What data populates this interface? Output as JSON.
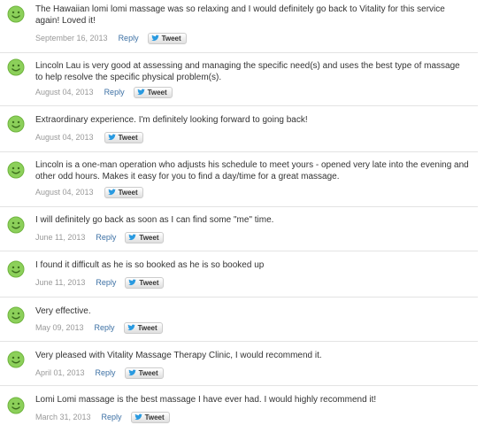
{
  "reviews": [
    {
      "text": "The Hawaiian lomi lomi massage was so relaxing and I would definitely go back to Vitality for this service again! Loved it!",
      "date": "September 16, 2013",
      "reply": "Reply",
      "tweet": "Tweet"
    },
    {
      "text": "Lincoln Lau is very good at assessing and managing the specific need(s) and uses the best type of massage to help resolve the specific physical problem(s).",
      "date": "August 04, 2013",
      "reply": "Reply",
      "tweet": "Tweet"
    },
    {
      "text": "Extraordinary experience. I'm definitely looking forward to going back!",
      "date": "August 04, 2013",
      "reply": "",
      "tweet": "Tweet"
    },
    {
      "text": "Lincoln is a one-man operation who adjusts his schedule to meet yours - opened very late into the evening and other odd hours. Makes it easy for you to find a day/time for a great massage.",
      "date": "August 04, 2013",
      "reply": "",
      "tweet": "Tweet"
    },
    {
      "text": "I will definitely go back as soon as I can find some \"me\" time.",
      "date": "June 11, 2013",
      "reply": "Reply",
      "tweet": "Tweet"
    },
    {
      "text": "I found it difficult as he is so booked as he is so booked up",
      "date": "June 11, 2013",
      "reply": "Reply",
      "tweet": "Tweet"
    },
    {
      "text": "Very effective.",
      "date": "May 09, 2013",
      "reply": "Reply",
      "tweet": "Tweet"
    },
    {
      "text": "Very pleased with Vitality Massage Therapy Clinic, I would recommend it.",
      "date": "April 01, 2013",
      "reply": "Reply",
      "tweet": "Tweet"
    },
    {
      "text": "Lomi Lomi massage is the best massage I have ever had. I would highly recommend it!",
      "date": "March 31, 2013",
      "reply": "Reply",
      "tweet": "Tweet"
    }
  ],
  "icons": {
    "rating": "smiley-face-icon",
    "tweet": "twitter-bird-icon"
  },
  "colors": {
    "link": "#3c70a4",
    "smiley": "#8cd05a",
    "meta": "#999999"
  }
}
